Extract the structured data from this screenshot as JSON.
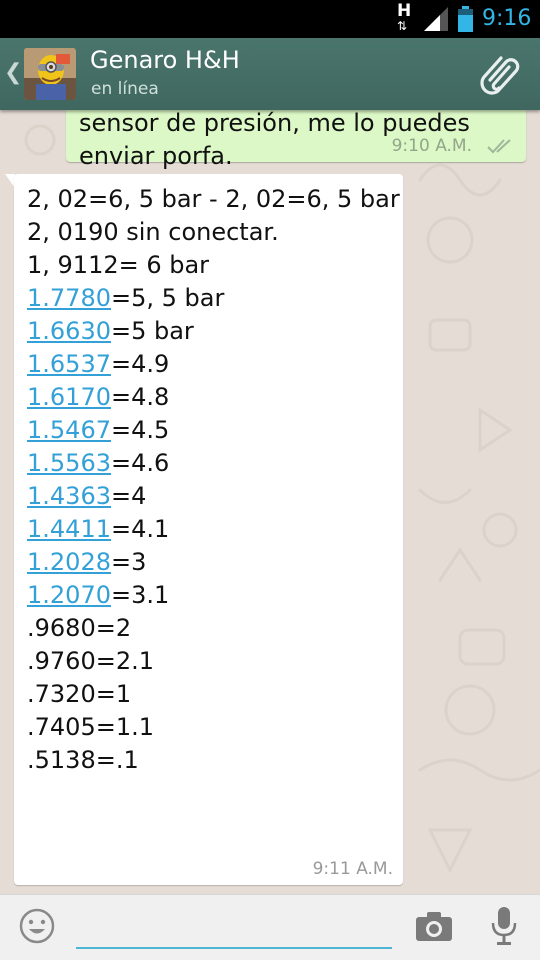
{
  "status_bar": {
    "network_label": "H",
    "time": "9:16"
  },
  "header": {
    "contact_name": "Genaro H&H",
    "contact_status": "en línea"
  },
  "messages": {
    "outgoing": {
      "line1": "sensor de presión, me lo puedes",
      "line2": "enviar porfa.",
      "time": "9:10 A.M."
    },
    "incoming": {
      "time": "9:11 A.M.",
      "lines": [
        {
          "link": "",
          "text": "2, 02=6, 5 bar - 2, 02=6, 5 bar"
        },
        {
          "link": "",
          "text": "2, 0190 sin conectar."
        },
        {
          "link": "",
          "text": "1, 9112= 6 bar"
        },
        {
          "link": "1.7780",
          "text": "=5, 5 bar"
        },
        {
          "link": "1.6630",
          "text": "=5 bar"
        },
        {
          "link": "1.6537",
          "text": "=4.9"
        },
        {
          "link": "1.6170",
          "text": "=4.8"
        },
        {
          "link": "1.5467",
          "text": "=4.5"
        },
        {
          "link": "1.5563",
          "text": "=4.6"
        },
        {
          "link": "1.4363",
          "text": "=4"
        },
        {
          "link": "1.4411",
          "text": "=4.1"
        },
        {
          "link": "1.2028",
          "text": "=3"
        },
        {
          "link": "1.2070",
          "text": "=3.1"
        },
        {
          "link": "",
          "text": ".9680=2"
        },
        {
          "link": "",
          "text": ".9760=2.1"
        },
        {
          "link": "",
          "text": ".7320=1"
        },
        {
          "link": "",
          "text": ".7405=1.1"
        },
        {
          "link": "",
          "text": ".5138=.1"
        }
      ]
    }
  },
  "input_bar": {
    "placeholder": ""
  },
  "icons": {
    "up": "back-caret-icon",
    "attach": "paperclip-icon",
    "emoji": "smiley-icon",
    "camera": "camera-icon",
    "mic": "microphone-icon",
    "read": "double-check-icon"
  },
  "colors": {
    "action_bar": "#456d66",
    "outgoing_bubble": "#dcf8c6",
    "incoming_bubble": "#ffffff",
    "link": "#33a0d8",
    "clock": "#33b5e5"
  }
}
